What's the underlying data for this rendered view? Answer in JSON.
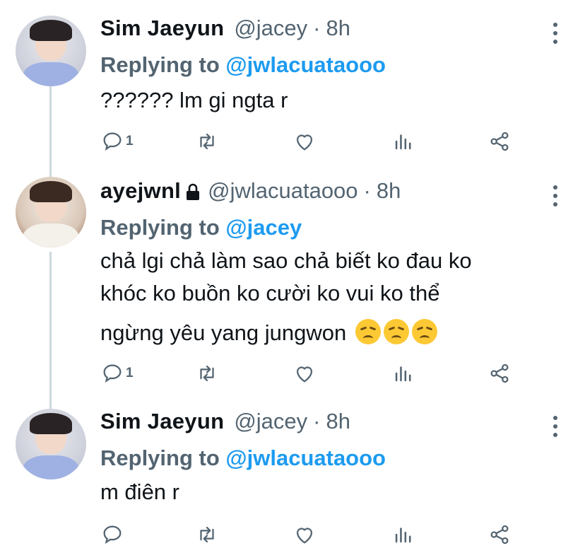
{
  "tweets": [
    {
      "name": "Sim Jaeyun",
      "handle": "@jacey",
      "dot": "·",
      "time": "8h",
      "replying_label": "Replying to ",
      "replying_handle": "@jwlacuataooo",
      "text_lines": [
        "?????? lm gi ngta r"
      ],
      "reply_count": "1",
      "avatar_icon": "avatar-jaeyun"
    },
    {
      "name": "ayejwnl",
      "locked": true,
      "handle": "@jwlacuataooo",
      "dot": "·",
      "time": "8h",
      "replying_label": "Replying to ",
      "replying_handle": "@jacey",
      "text_lines": [
        "chả lgi chả làm sao chả biết ko đau ko",
        "khóc ko buồn ko cười ko vui ko thể",
        "ngừng yêu yang jungwon"
      ],
      "emojis": [
        "disappointed-face",
        "disappointed-face",
        "disappointed-face"
      ],
      "reply_count": "1",
      "avatar_icon": "avatar-ayejwnl"
    },
    {
      "name": "Sim Jaeyun",
      "handle": "@jacey",
      "dot": "·",
      "time": "8h",
      "replying_label": "Replying to ",
      "replying_handle": "@jwlacuataooo",
      "text_lines": [
        "m điên r"
      ],
      "reply_count": "",
      "avatar_icon": "avatar-jaeyun"
    }
  ],
  "colors": {
    "accent": "#1d9bf0",
    "secondary": "#536471",
    "text": "#0f1419",
    "thread_line": "#cfd9de"
  }
}
